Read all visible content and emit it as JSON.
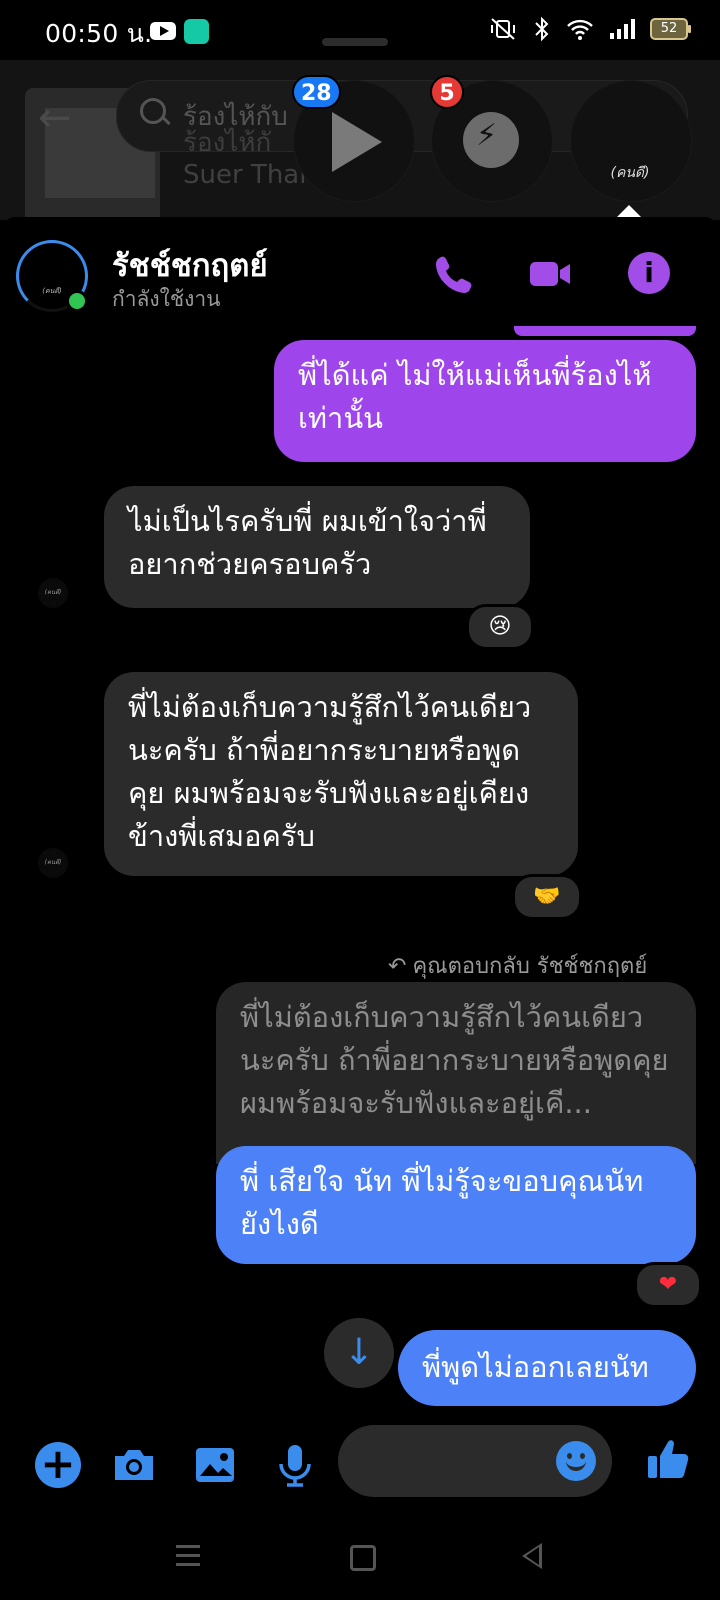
{
  "status_bar": {
    "time": "00:50 น.",
    "battery": "52"
  },
  "background": {
    "search_placeholder": "ร้องไห้กับ",
    "song_title": "ร้องไห้กั",
    "song_artist": "Suer Thai"
  },
  "chat_heads": [
    {
      "badge": "28"
    },
    {
      "badge": "5"
    },
    {
      "label": "(คนดี)"
    }
  ],
  "header": {
    "avatar_label": "(คนดี)",
    "name": "รัชช์ชกฤตย์",
    "status": "กำลังใช้งาน"
  },
  "messages": [
    {
      "from": "me",
      "text": "พี่ได้แค่ ไม่ให้แม่เห็นพี่ร้องไห้เท่านั้น"
    },
    {
      "from": "them",
      "avatar_label": "(คนดี)",
      "text": "ไม่เป็นไรครับพี่ ผมเข้าใจว่าพี่อยากช่วยครอบครัว",
      "reaction": "😢"
    },
    {
      "from": "them",
      "avatar_label": "(คนดี)",
      "text": "พี่ไม่ต้องเก็บความรู้สึกไว้คนเดียวนะครับ ถ้าพี่อยากระบายหรือพูดคุย ผมพร้อมจะรับฟังและอยู่เคียงข้างพี่เสมอครับ",
      "reaction": "🤝"
    },
    {
      "from": "me",
      "reply_label": "คุณตอบกลับ รัชช์ชกฤตย์",
      "quote": "พี่ไม่ต้องเก็บความรู้สึกไว้คนเดียวนะครับ ถ้าพี่อยากระบายหรือพูดคุย ผมพร้อมจะรับฟังและอยู่เคี...",
      "text": "พี่ เสียใจ นัท พี่ไม่รู้จะขอบคุณนัทยังไงดี",
      "reaction": "❤"
    },
    {
      "from": "me",
      "text": "พี่พูดไม่ออกเลยนัท"
    }
  ],
  "composer": {
    "input_value": "",
    "input_placeholder": ""
  },
  "colors": {
    "accent": "#3b8ded",
    "my_bubble_purple": "#9f45ec",
    "my_bubble_blue": "#4d81f7",
    "their_bubble": "#2b2b2b",
    "online": "#31c653"
  }
}
